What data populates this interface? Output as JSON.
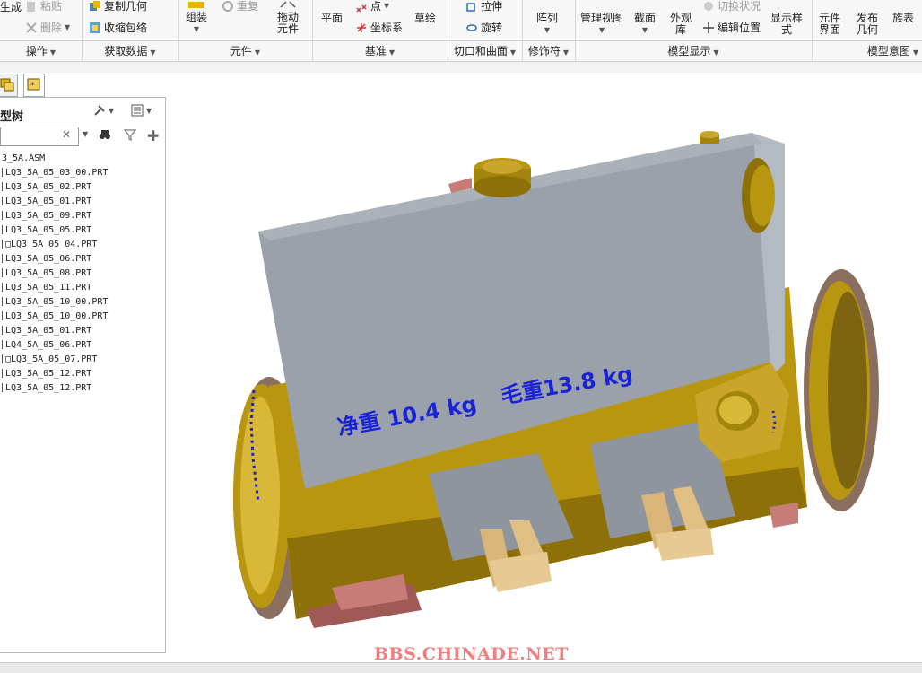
{
  "ribbon": {
    "ops": {
      "paste": "粘贴",
      "delete": "删除",
      "generate": "生成",
      "label": "操作"
    },
    "get_data": {
      "copy_geom": "复制几何",
      "shrinkwrap": "收缩包络",
      "label": "获取数据"
    },
    "component": {
      "assemble": "组装",
      "repeat": "重复",
      "drag": "拖动\n元件",
      "label": "元件"
    },
    "datum": {
      "plane": "平面",
      "point": "点",
      "csys": "坐标系",
      "sketch": "草绘",
      "label": "基准"
    },
    "cut_surface": {
      "extrude": "拉伸",
      "revolve": "旋转",
      "label": "切口和曲面"
    },
    "modifiers": {
      "pattern": "阵列",
      "label": "修饰符"
    },
    "model_display": {
      "manage_views": "管理视图",
      "section": "截面",
      "appearance": "外观\n库",
      "toggle_status": "切换状况",
      "edit_position": "编辑位置",
      "display_style": "显示样\n式",
      "label": "模型显示"
    },
    "model_intent": {
      "comp_interface": "元件\n界面",
      "publish_geom": "发布\n几何",
      "family_table": "族表",
      "label": "模型意图"
    }
  },
  "tree": {
    "title": "型树",
    "root": "3_5A.ASM",
    "items": [
      "LQ3_5A_05_03_00.PRT",
      "LQ3_5A_05_02.PRT",
      "LQ3_5A_05_01.PRT",
      "LQ3_5A_05_09.PRT",
      "LQ3_5A_05_05.PRT",
      "□LQ3_5A_05_04.PRT",
      "LQ3_5A_05_06.PRT",
      "LQ3_5A_05_08.PRT",
      "LQ3_5A_05_11.PRT",
      "LQ3_5A_05_10_00.PRT",
      "LQ3_5A_05_10_00.PRT",
      "LQ3_5A_05_01.PRT",
      "LQ4_5A_05_06.PRT",
      "□LQ3_5A_05_07.PRT",
      "LQ3_5A_05_12.PRT",
      "LQ3_5A_05_12.PRT"
    ]
  },
  "model": {
    "annotation_net": "净重 10.4  kg",
    "annotation_gross": "毛重13.8  kg",
    "annotation_color": "#1a22d6"
  },
  "watermark": "BBS.CHINADE.NET",
  "colors": {
    "brass": "#b8960f",
    "box": "#9aa1aa",
    "pink": "#c87c78",
    "sand": "#e0bf85"
  }
}
